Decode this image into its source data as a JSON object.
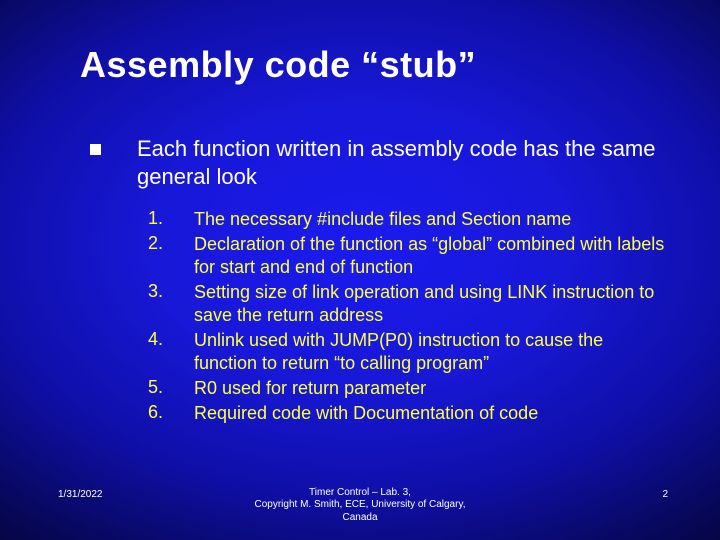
{
  "title": "Assembly code “stub”",
  "lead": "Each function written in assembly code has the same general look",
  "items": [
    {
      "n": "1.",
      "text": "The necessary #include files and Section name"
    },
    {
      "n": "2.",
      "text": "Declaration of the function as “global” combined with labels for start and end of function"
    },
    {
      "n": "3.",
      "text": "Setting size of link operation and using LINK instruction to save the return address"
    },
    {
      "n": "4.",
      "text": "Unlink used with JUMP(P0) instruction to cause the function to return “to calling program”"
    },
    {
      "n": "5.",
      "text": "R0 used for return parameter"
    },
    {
      "n": "6.",
      "text": "Required code with Documentation of code"
    }
  ],
  "footer": {
    "date": "1/31/2022",
    "center_line1": "Timer Control – Lab. 3,",
    "center_line2": "Copyright M. Smith, ECE, University of Calgary,",
    "center_line3": "Canada",
    "page": "2"
  }
}
